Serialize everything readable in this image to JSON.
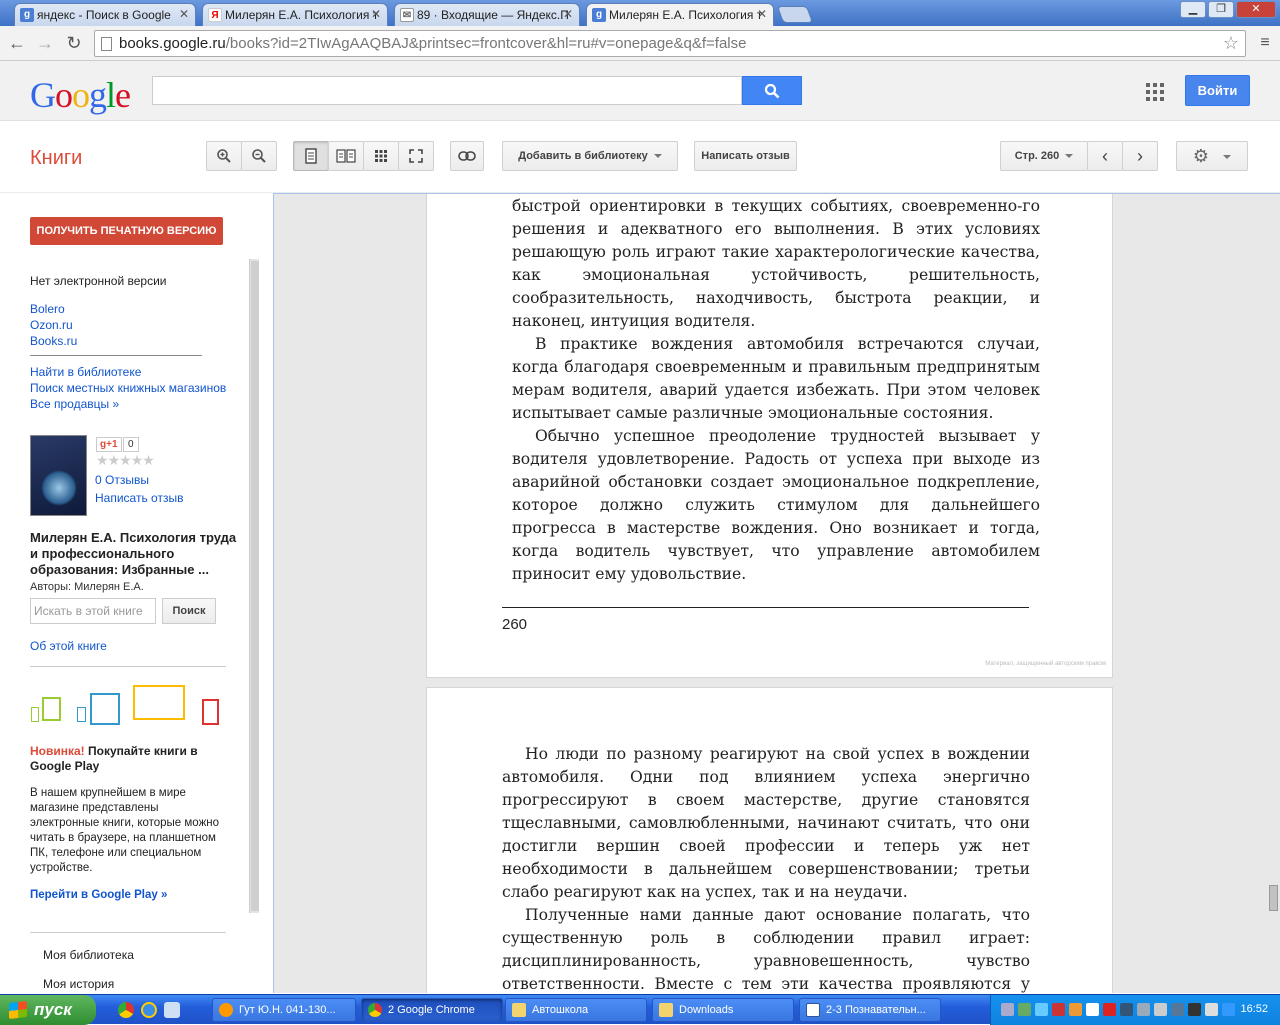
{
  "browser": {
    "tabs": [
      {
        "label": "яндекс - Поиск в Google",
        "favicon": "google-g-icon",
        "active": false
      },
      {
        "label": "Милерян Е.А. Психология т",
        "favicon": "yandex-icon",
        "active": false
      },
      {
        "label": "89 · Входящие — Яндекс.П",
        "favicon": "mail-icon",
        "active": false
      },
      {
        "label": "Милерян Е.А. Психология т",
        "favicon": "google-g-icon",
        "active": true
      }
    ],
    "url_host": "books.google.ru",
    "url_path": "/books?id=2TIwAgAAQBAJ&printsec=frontcover&hl=ru#v=onepage&q&f=false"
  },
  "header": {
    "logo_letters": [
      "G",
      "o",
      "o",
      "g",
      "l",
      "e"
    ],
    "logo_colors": [
      "#3369e8",
      "#d50f25",
      "#eeb211",
      "#3369e8",
      "#009925",
      "#d50f25"
    ],
    "signin_label": "Войти"
  },
  "books_toolbar": {
    "section_label": "Книги",
    "add_library_label": "Добавить в библиотеку",
    "write_review_label": "Написать отзыв",
    "page_label": "Стр. 260"
  },
  "sidebar": {
    "print_button": "ПОЛУЧИТЬ ПЕЧАТНУЮ ВЕРСИЮ",
    "no_ebook": "Нет электронной версии",
    "sellers": [
      "Bolero",
      "Ozon.ru",
      "Books.ru"
    ],
    "library_links": [
      "Найти в библиотеке",
      "Поиск местных книжных магазинов",
      "Все продавцы »"
    ],
    "gplus": "g+1",
    "gplus_count": "0",
    "rating": 0,
    "reviews_link": "0 Отзывы",
    "write_review_link": "Написать отзыв",
    "book_title": "Милерян Е.А. Психология труда и профессионального образования: Избранные ...",
    "authors": "Авторы: Милерян Е.А.",
    "search_placeholder": "Искать в этой книге",
    "search_button": "Поиск",
    "about_link": "Об этой книге",
    "promo_new": "Новинка!",
    "promo_title": "Покупайте книги в Google Play",
    "promo_text": "В нашем крупнейшем в мире магазине представлены электронные книги, которые можно читать в браузере, на планшетном ПК, телефоне или специальном устройстве.",
    "promo_link": "Перейти в Google Play »",
    "my_library": "Моя библиотека",
    "my_history": "Моя история"
  },
  "reader": {
    "page1_lines_p1": "быстрой ориентировки в текущих событиях, своевременно-го решения и адекватного его выполнения. В этих условиях решающую роль играют такие характерологические качества, как эмоциональная устойчивость, решительность, сообразительность, находчивость, быстрота реакции, и наконец, интуиция водителя.",
    "page1_p2": "В практике вождения автомобиля встречаются случаи, когда благодаря своевременным и правильным предпринятым мерам водителя, аварий удается избежать. При этом человек испытывает самые различные эмоциональные состояния.",
    "page1_p3": "Обычно успешное преодоление трудностей вызывает у водителя удовлетворение. Радость от успеха при выходе из аварийной обстановки создает эмоциональное подкрепление, которое должно служить стимулом для дальнейшего прогресса в мастерстве вождения. Оно возникает и тогда, когда водитель чувствует, что управление автомобилем приносит ему удовольствие.",
    "page_number": "260",
    "copyright": "Материал, защищенный авторским правом",
    "page2_p1": "Но люди по разному реагируют на свой успех в вождении автомобиля. Одни под влиянием успеха энергично прогрессируют в своем мастерстве, другие становятся тщеславными, самовлюбленными, начинают считать, что они достигли вершин своей профессии и теперь уж нет необходимости в дальнейшем совершенствовании; третьи слабо реагируют как на успех, так и на неудачи.",
    "page2_p2": "Полученные нами данные дают основание полагать, что существенную роль в соблюдении правил играет: дисциплинированность, уравновешенность, чувство ответственности. Вместе с тем эти качества проявляются у разных людей"
  },
  "taskbar": {
    "start_label": "пуск",
    "tasks": [
      {
        "label": "Гут Ю.Н. 041-130...",
        "icon": "smiley-icon",
        "active": false
      },
      {
        "label": "2 Google Chrome",
        "icon": "chrome-icon",
        "active": true
      },
      {
        "label": "Автошкола",
        "icon": "folder-icon",
        "active": false
      },
      {
        "label": "Downloads",
        "icon": "folder-icon",
        "active": false
      },
      {
        "label": "2-3 Познавательн...",
        "icon": "word-doc-icon",
        "active": false
      }
    ],
    "clock": "16:52"
  }
}
